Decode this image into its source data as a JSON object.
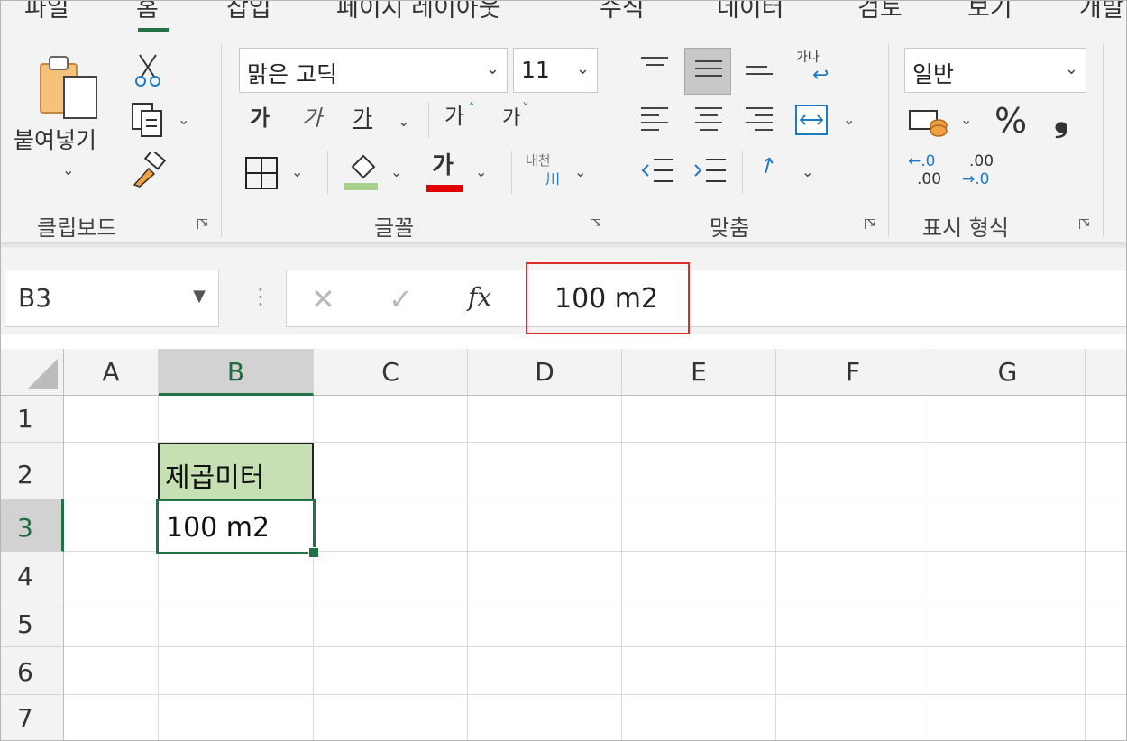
{
  "tabs": [
    "파일",
    "홈",
    "삽입",
    "페이지 레이아웃",
    "수식",
    "데이터",
    "검토",
    "보기",
    "개발"
  ],
  "ribbon": {
    "clipboard": {
      "paste_label": "붙여넣기",
      "group_label": "클립보드"
    },
    "font": {
      "font_name": "맑은 고딕",
      "font_size": "11",
      "bold": "가",
      "italic": "가",
      "underline": "가",
      "grow": "가",
      "shrink": "가",
      "font_color_glyph": "가",
      "phonetic": "내천",
      "group_label": "글꼴"
    },
    "alignment": {
      "orient": "가나",
      "group_label": "맞춤"
    },
    "number": {
      "format": "일반",
      "percent": "%",
      "comma": "❟",
      "inc_top": "←.0",
      "inc_bottom": ".00",
      "dec_top": ".00",
      "dec_bottom": "→.0",
      "group_label": "표시 형식"
    }
  },
  "formula_bar": {
    "name_box": "B3",
    "cancel": "✕",
    "enter": "✓",
    "fx": "fx",
    "content": "100 m2"
  },
  "sheet": {
    "columns": [
      "A",
      "B",
      "C",
      "D",
      "E",
      "F",
      "G"
    ],
    "rows": [
      "1",
      "2",
      "3",
      "4",
      "5",
      "6",
      "7"
    ],
    "selected_column": "B",
    "selected_row": "3",
    "cells": {
      "B2": "제곱미터",
      "B3": "100 m2"
    },
    "accent_color": "#217346",
    "b2_fill": "#c6e0b4",
    "highlight_color": "#e02b2b"
  },
  "icons": [
    "scissors-icon",
    "copy-icon",
    "format-painter-icon",
    "borders-icon",
    "fill-color-icon",
    "wrap-text-icon",
    "merge-center-icon",
    "currency-icon"
  ]
}
